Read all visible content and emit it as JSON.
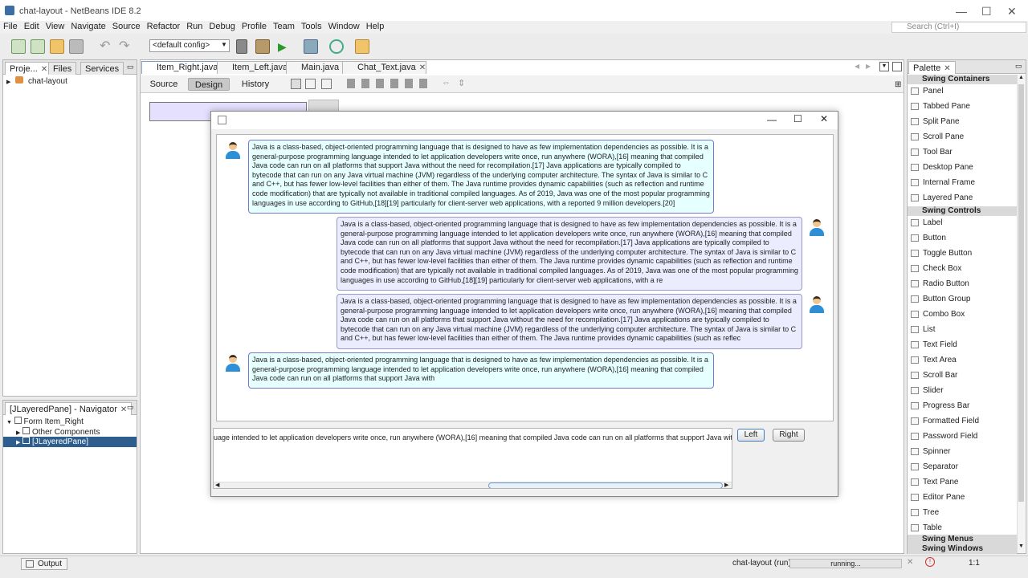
{
  "window": {
    "title": "chat-layout - NetBeans IDE 8.2",
    "minimize": "—",
    "maximize": "☐",
    "close": "✕"
  },
  "menu": [
    "File",
    "Edit",
    "View",
    "Navigate",
    "Source",
    "Refactor",
    "Run",
    "Debug",
    "Profile",
    "Team",
    "Tools",
    "Window",
    "Help"
  ],
  "search": {
    "placeholder": "Search (Ctrl+I)"
  },
  "toolbar": {
    "config": "<default config>"
  },
  "projects_panel": {
    "tabs": [
      "Proje...",
      "Files",
      "Services"
    ],
    "tree": [
      "chat-layout"
    ]
  },
  "navigator": {
    "title": "[JLayeredPane] - Navigator",
    "tree": [
      "Form Item_Right",
      "Other Components",
      "[JLayeredPane]"
    ]
  },
  "editor": {
    "tabs": [
      "Item_Right.java",
      "Item_Left.java",
      "Main.java",
      "Chat_Text.java"
    ],
    "views": [
      "Source",
      "Design",
      "History"
    ]
  },
  "palette": {
    "title": "Palette",
    "sections": [
      {
        "name": "Swing Containers",
        "items": [
          "Panel",
          "Tabbed Pane",
          "Split Pane",
          "Scroll Pane",
          "Tool Bar",
          "Desktop Pane",
          "Internal Frame",
          "Layered Pane"
        ]
      },
      {
        "name": "Swing Controls",
        "items": [
          "Label",
          "Button",
          "Toggle Button",
          "Check Box",
          "Radio Button",
          "Button Group",
          "Combo Box",
          "List",
          "Text Field",
          "Text Area",
          "Scroll Bar",
          "Slider",
          "Progress Bar",
          "Formatted Field",
          "Password Field",
          "Spinner",
          "Separator",
          "Text Pane",
          "Editor Pane",
          "Tree",
          "Table"
        ]
      },
      {
        "name": "Swing Menus",
        "items": []
      },
      {
        "name": "Swing Windows",
        "items": []
      }
    ]
  },
  "chat": {
    "messages": [
      {
        "side": "left",
        "text": "Java is a class-based, object-oriented programming language that is designed to have as few implementation dependencies as possible. It is a general-purpose programming language intended to let application developers write once, run anywhere (WORA),[16] meaning that compiled Java code can run on all platforms that support Java without the need for recompilation.[17] Java applications are typically compiled to bytecode that can run on any Java virtual machine (JVM) regardless of the underlying computer architecture. The syntax of Java is similar to C and C++, but has fewer low-level facilities than either of them. The Java runtime provides dynamic capabilities (such as reflection and runtime code modification) that are typically not available in traditional compiled languages. As of 2019, Java was one of the most popular programming languages in use according to GitHub,[18][19] particularly for client-server web applications, with a reported 9 million developers.[20]"
      },
      {
        "side": "right",
        "text": "Java is a class-based, object-oriented programming language that is designed to have as few implementation dependencies as possible. It is a general-purpose programming language intended to let application developers write once, run anywhere (WORA),[16] meaning that compiled Java code can run on all platforms that support Java without the need for recompilation.[17] Java applications are typically compiled to bytecode that can run on any Java virtual machine (JVM) regardless of the underlying computer architecture. The syntax of Java is similar to C and C++, but has fewer low-level facilities than either of them. The Java runtime provides dynamic capabilities (such as reflection and runtime code modification) that are typically not available in traditional compiled languages. As of 2019, Java was one of the most popular programming languages in use according to GitHub,[18][19] particularly for client-server web applications, with a re"
      },
      {
        "side": "right",
        "text": "Java is a class-based, object-oriented programming language that is designed to have as few implementation dependencies as possible. It is a general-purpose programming language intended to let application developers write once, run anywhere (WORA),[16] meaning that compiled Java code can run on all platforms that support Java without the need for recompilation.[17] Java applications are typically compiled to bytecode that can run on any Java virtual machine (JVM) regardless of the underlying computer architecture. The syntax of Java is similar to C and C++, but has fewer low-level facilities than either of them. The Java runtime provides dynamic capabilities (such as reflec"
      },
      {
        "side": "left",
        "text": "Java is a class-based, object-oriented programming language that is designed to have as few implementation dependencies as possible. It is a general-purpose programming language intended to let application developers write once, run anywhere (WORA),[16] meaning that compiled Java code can run on all platforms that support Java with"
      }
    ],
    "input_text": "uage intended to let application developers write once, run anywhere (WORA),[16] meaning that compiled Java code can run on all platforms that support Java with",
    "left_button": "Left",
    "right_button": "Right"
  },
  "statusbar": {
    "output": "Output",
    "project": "chat-layout (run)",
    "status": "running...",
    "position": "1:1"
  }
}
